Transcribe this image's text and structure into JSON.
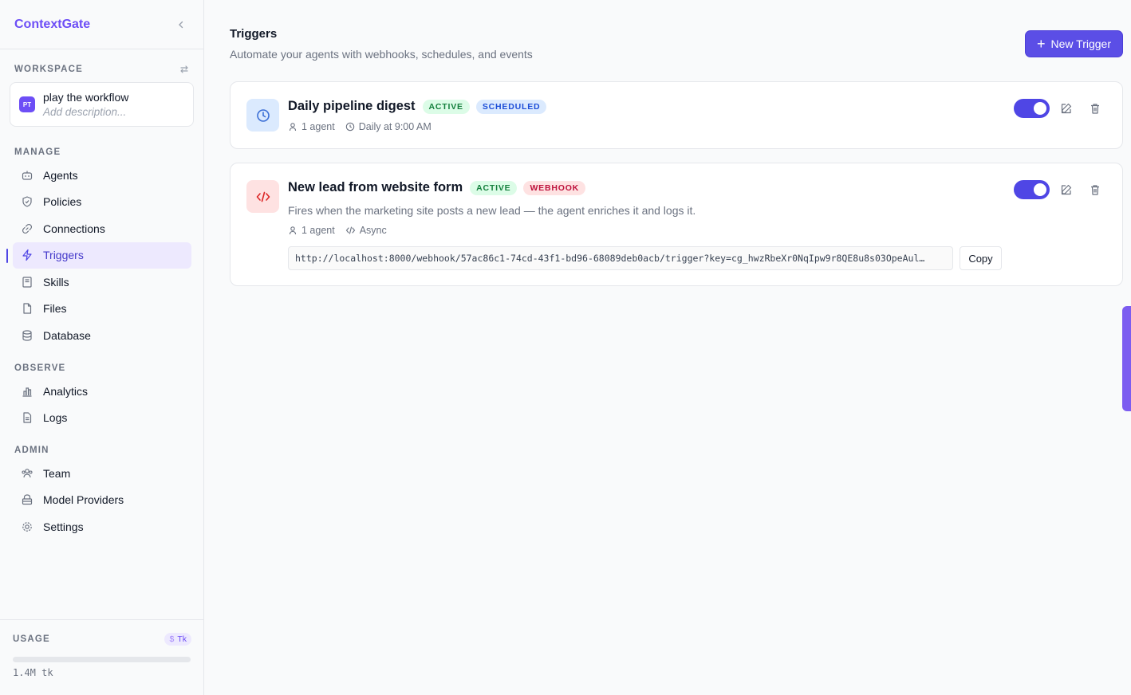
{
  "sidebar": {
    "brand_context": "Context",
    "brand_gate": "Gate",
    "workspace_label": "WORKSPACE",
    "workspace": {
      "avatar": "PT",
      "name": "play the workflow",
      "description_placeholder": "Add description..."
    },
    "manage_label": "MANAGE",
    "manage_items": [
      {
        "label": "Agents",
        "icon": "bot-icon"
      },
      {
        "label": "Policies",
        "icon": "shield-icon"
      },
      {
        "label": "Connections",
        "icon": "link-icon"
      },
      {
        "label": "Triggers",
        "icon": "zap-icon",
        "active": true
      },
      {
        "label": "Skills",
        "icon": "book-icon"
      },
      {
        "label": "Files",
        "icon": "file-icon"
      },
      {
        "label": "Database",
        "icon": "database-icon"
      }
    ],
    "observe_label": "OBSERVE",
    "observe_items": [
      {
        "label": "Analytics",
        "icon": "bar-chart-icon"
      },
      {
        "label": "Logs",
        "icon": "file-text-icon"
      }
    ],
    "admin_label": "ADMIN",
    "admin_items": [
      {
        "label": "Team",
        "icon": "users-icon"
      },
      {
        "label": "Model Providers",
        "icon": "lock-box-icon"
      },
      {
        "label": "Settings",
        "icon": "gear-icon"
      }
    ],
    "usage": {
      "label": "USAGE",
      "unit_dollar": "$",
      "unit_tokens": "Tk",
      "value": "1.4M tk",
      "fill_fraction": 0
    }
  },
  "header": {
    "title": "Triggers",
    "subtitle": "Automate your agents with webhooks, schedules, and events",
    "new_button": "New Trigger"
  },
  "triggers": [
    {
      "name": "Daily pipeline digest",
      "status": "ACTIVE",
      "type": "SCHEDULED",
      "agents": "1 agent",
      "schedule": "Daily at 9:00 AM",
      "enabled": true
    },
    {
      "name": "New lead from website form",
      "status": "ACTIVE",
      "type": "WEBHOOK",
      "description": "Fires when the marketing site posts a new lead — the agent enriches it and logs it.",
      "agents": "1 agent",
      "mode": "Async",
      "url": "http://localhost:8000/webhook/57ac86c1-74cd-43f1-bd96-68089deb0acb/trigger?key=cg_hwzRbeXr0NqIpw9r8QE8u8s03OpeAul…",
      "copy_label": "Copy",
      "enabled": true
    }
  ],
  "colors": {
    "accent": "#4f46e5",
    "brand": "#6d4ef6"
  }
}
